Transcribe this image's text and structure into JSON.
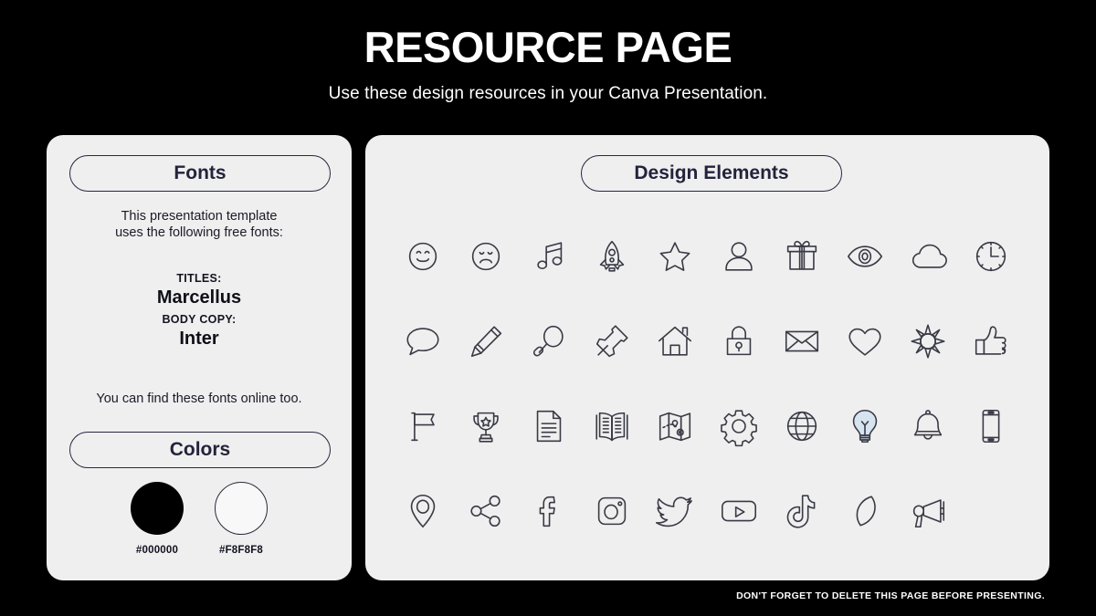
{
  "header": {
    "title": "RESOURCE PAGE",
    "subtitle": "Use these design resources in your Canva Presentation."
  },
  "fonts_card": {
    "pill_label": "Fonts",
    "intro_line_1": "This presentation template",
    "intro_line_2": "uses the following free fonts:",
    "titles_label": "TITLES:",
    "titles_font": "Marcellus",
    "body_label": "BODY COPY:",
    "body_font": "Inter",
    "note": "You can find these fonts online too."
  },
  "colors_section": {
    "pill_label": "Colors",
    "swatches": [
      {
        "name": "black-swatch",
        "hex": "#000000",
        "label": "#000000",
        "bordered": false
      },
      {
        "name": "off-white-swatch",
        "hex": "#F8F8F8",
        "label": "#F8F8F8",
        "bordered": true
      }
    ]
  },
  "design_card": {
    "pill_label": "Design Elements",
    "icons": [
      "smiley-face-icon",
      "sad-face-icon",
      "music-note-icon",
      "rocket-icon",
      "star-icon",
      "person-icon",
      "gift-icon",
      "eye-icon",
      "cloud-icon",
      "clock-icon",
      "speech-bubble-icon",
      "pencil-icon",
      "magnifying-glass-icon",
      "push-pin-icon",
      "house-icon",
      "lock-icon",
      "envelope-icon",
      "heart-icon",
      "sun-icon",
      "thumbs-up-icon",
      "flag-icon",
      "trophy-icon",
      "document-icon",
      "open-book-icon",
      "map-icon",
      "gear-icon",
      "globe-icon",
      "lightbulb-icon",
      "bell-icon",
      "phone-icon",
      "location-pin-icon",
      "share-icon",
      "facebook-icon",
      "instagram-icon",
      "twitter-icon",
      "youtube-icon",
      "tiktok-icon",
      "moon-icon",
      "megaphone-icon"
    ]
  },
  "footer": {
    "note": "DON'T FORGET TO DELETE THIS PAGE BEFORE PRESENTING."
  },
  "theme": {
    "background": "#000000",
    "card_background": "#EFEFEF",
    "outline": "#272741",
    "text_dark": "#1b1b28",
    "text_light": "#FFFFFF",
    "icon_stroke": "#3a3a46",
    "lightbulb_accent": "#D6E4F0"
  }
}
